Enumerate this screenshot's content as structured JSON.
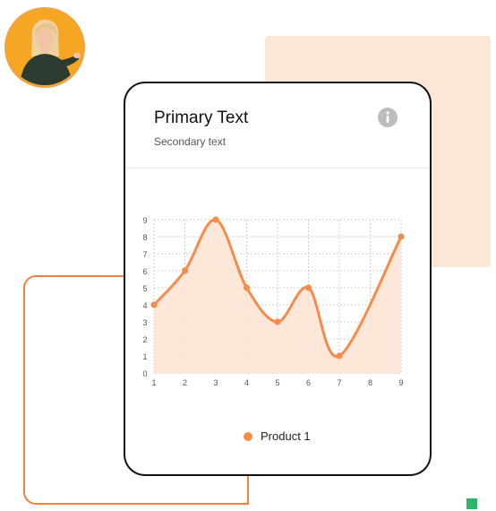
{
  "card": {
    "title": "Primary Text",
    "subtitle": "Secondary text",
    "info_icon": "info-icon"
  },
  "colors": {
    "accent": "#f48c4b",
    "fill": "#fde3d2",
    "peach_block": "#fde6d8",
    "bracket": "#f0813f"
  },
  "chart_data": {
    "type": "area",
    "x": [
      1,
      2,
      3,
      4,
      5,
      6,
      7,
      8,
      9
    ],
    "y_tick_labels": [
      "0",
      "1",
      "2",
      "3",
      "4",
      "5",
      "6",
      "7",
      "8",
      "9"
    ],
    "series": [
      {
        "name": "Product 1",
        "points": [
          [
            1,
            4
          ],
          [
            2,
            6
          ],
          [
            3,
            9
          ],
          [
            4,
            5
          ],
          [
            5,
            3
          ],
          [
            6,
            5
          ],
          [
            7,
            1
          ],
          [
            9,
            8
          ]
        ]
      }
    ],
    "xlim": [
      1,
      9
    ],
    "ylim": [
      0,
      9
    ],
    "grid": true,
    "grid_style": "dotted",
    "smooth": true,
    "legend_position": "bottom-center"
  }
}
